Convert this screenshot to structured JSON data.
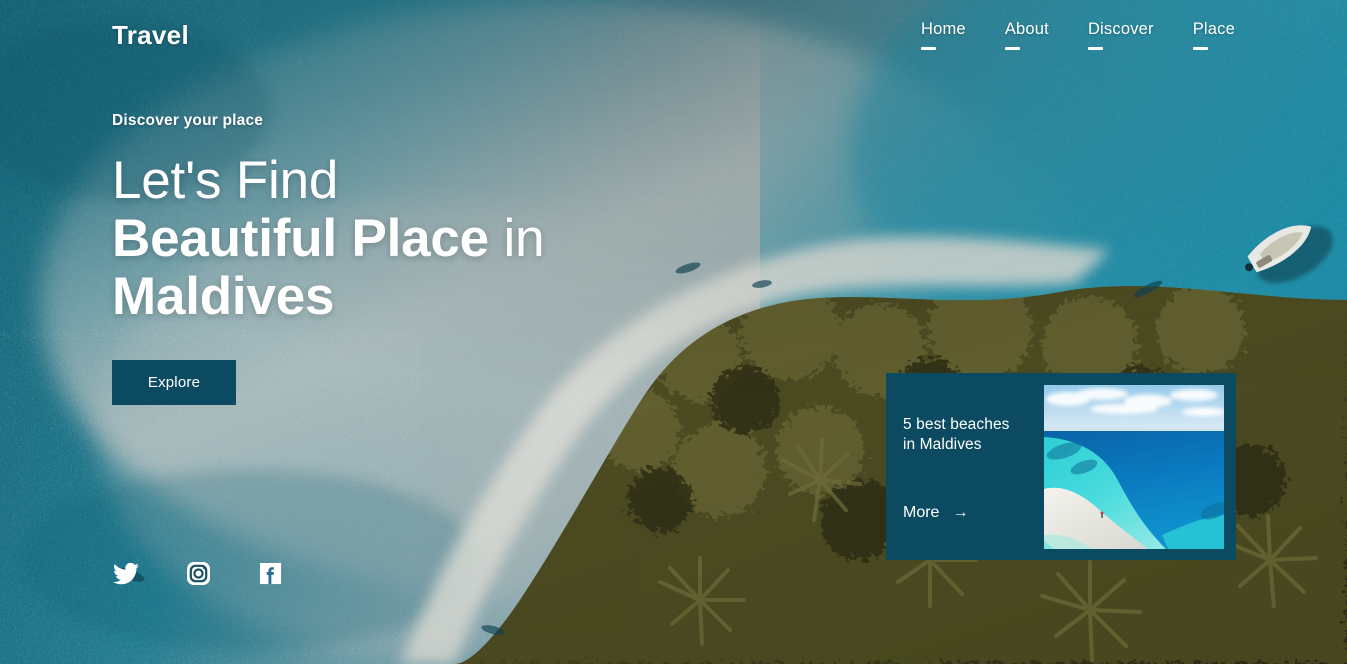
{
  "header": {
    "brand": "Travel",
    "nav": [
      {
        "label": "Home"
      },
      {
        "label": "About"
      },
      {
        "label": "Discover"
      },
      {
        "label": "Place"
      }
    ]
  },
  "hero": {
    "eyebrow": "Discover your place",
    "line1": "Let's Find",
    "line2_bold": "Beautiful Place",
    "line2_rest": " in",
    "line3_bold": "Maldives",
    "cta_label": "Explore"
  },
  "social": [
    {
      "name": "twitter-icon",
      "label": "Twitter"
    },
    {
      "name": "instagram-icon",
      "label": "Instagram"
    },
    {
      "name": "facebook-icon",
      "label": "Facebook"
    }
  ],
  "promo_card": {
    "title_line1": "5 best beaches",
    "title_line2": "in Maldives",
    "more_label": "More",
    "more_arrow": "→",
    "thumbnail_alt": "Aerial view of white sandbar and turquoise lagoon"
  },
  "colors": {
    "accent_dark_teal": "#0b4a61",
    "text_on_photo": "#ffffff",
    "water_deep_teal": "#1f7b8c",
    "water_light": "#8fa7ad",
    "foliage_olive": "#6d6b35",
    "sand_white": "#e3e4df"
  },
  "background": {
    "description": "Aerial photograph of a Maldives island: teal ocean on the left, pale sandbar shallows across the middle, olive-green palm forest island in the lower right, white motorboat on the water at upper right"
  }
}
